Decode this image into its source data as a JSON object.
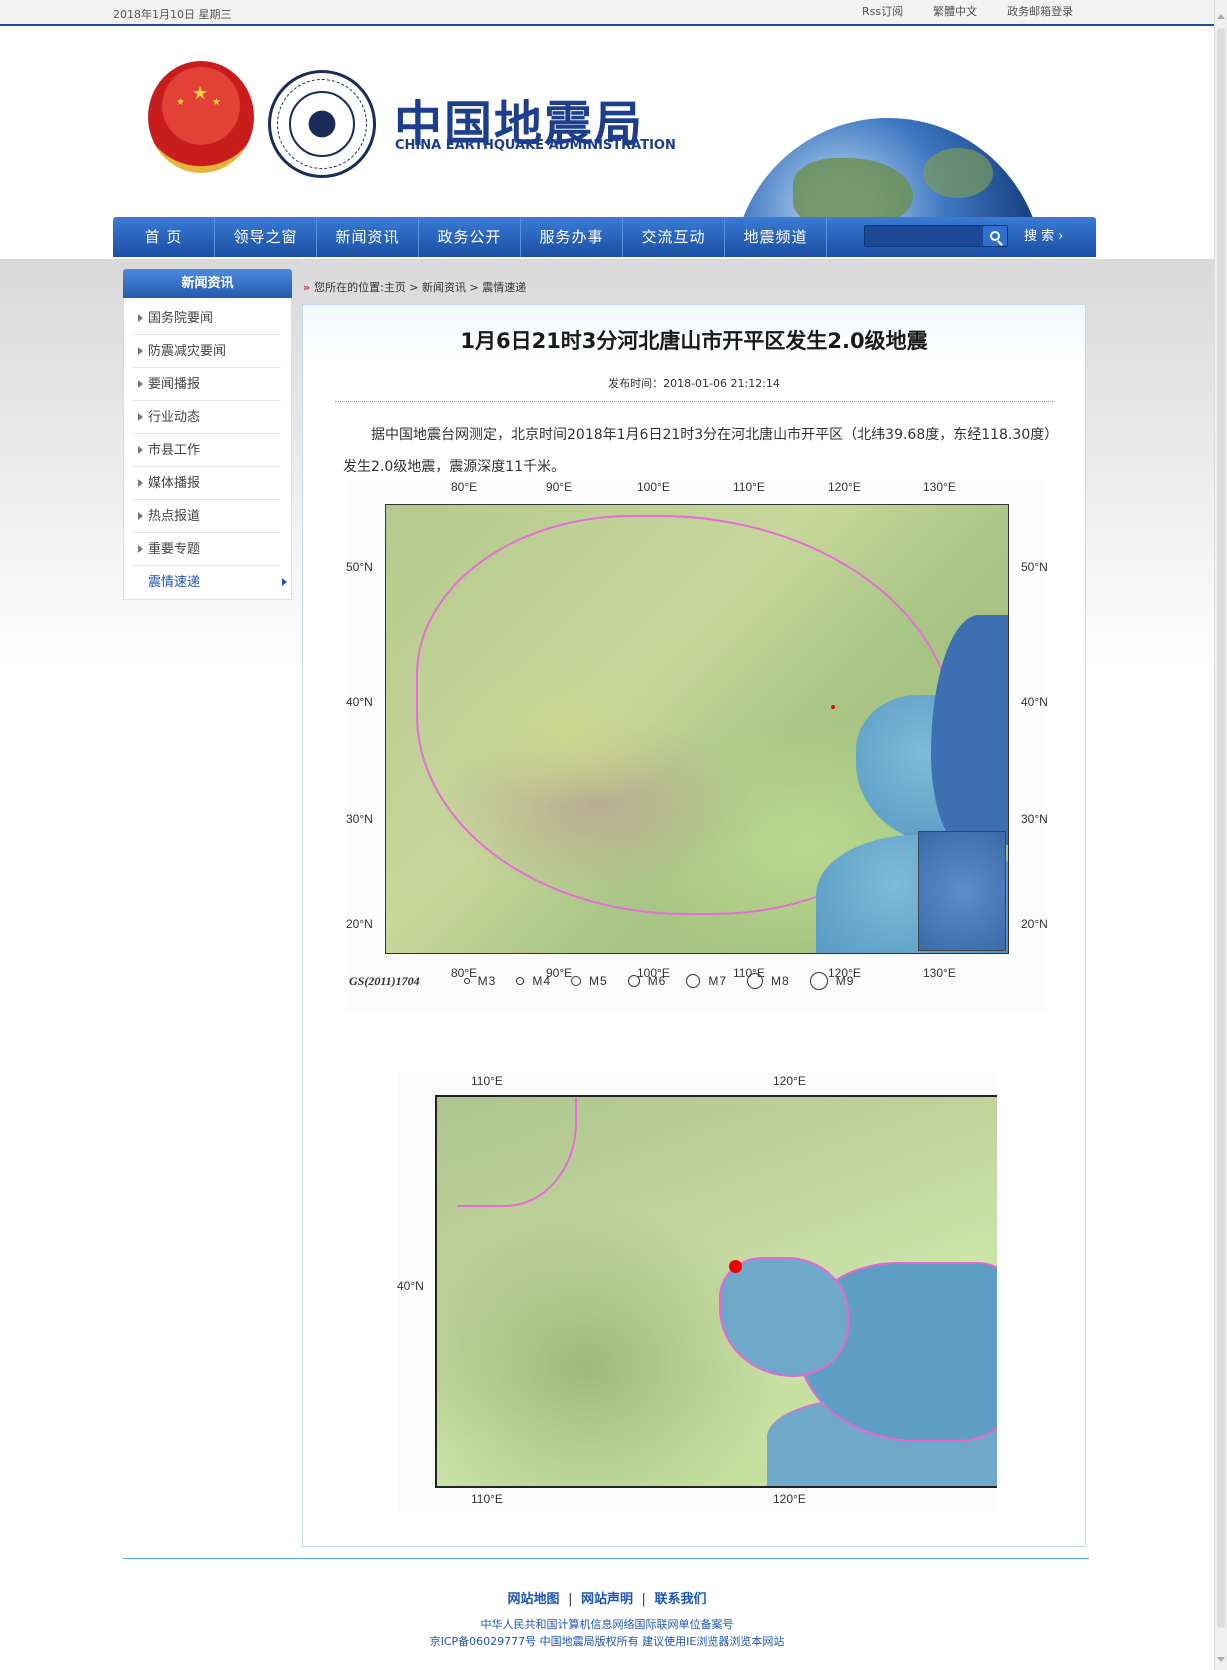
{
  "topbar": {
    "date": "2018年1月10日  星期三",
    "rss": "Rss订阅",
    "traditional": "繁體中文",
    "mail_login": "政务邮箱登录"
  },
  "logo": {
    "cn": "中国地震局",
    "en": "CHINA EARTHQUAKE ADMINISTRATION",
    "seal_text": "CHINA EARTHQUAKE ADMINISTRATION 中国地震局"
  },
  "nav": {
    "items": [
      "首  页",
      "领导之窗",
      "新闻资讯",
      "政务公开",
      "服务办事",
      "交流互动",
      "地震频道"
    ],
    "search_placeholder": "",
    "search_label": "搜  索 ›"
  },
  "sidebar": {
    "title": "新闻资讯",
    "items": [
      "国务院要闻",
      "防震减灾要闻",
      "要闻播报",
      "行业动态",
      "市县工作",
      "媒体播报",
      "热点报道",
      "重要专题",
      "震情速递"
    ],
    "active": "震情速递"
  },
  "breadcrumb": {
    "arrow": "»",
    "text": "您所在的位置:主页 > 新闻资讯 > 震情速递"
  },
  "article": {
    "title": "1月6日21时3分河北唐山市开平区发生2.0级地震",
    "pubtime": "发布时间：2018-01-06 21:12:14",
    "body": "据中国地震台网测定，北京时间2018年1月6日21时3分在河北唐山市开平区（北纬39.68度，东经118.30度）发生2.0级地震，震源深度11千米。"
  },
  "map1": {
    "lon_ticks": [
      "80°E",
      "90°E",
      "100°E",
      "110°E",
      "120°E",
      "130°E"
    ],
    "lat_ticks": [
      "50°N",
      "40°N",
      "30°N",
      "20°N"
    ],
    "gs": "GS(2011)1704",
    "legend": [
      "M3",
      "M4",
      "M5",
      "M6",
      "M7",
      "M8",
      "M9"
    ]
  },
  "map2": {
    "lon_ticks": [
      "110°E",
      "120°E"
    ],
    "lat_ticks": [
      "40°N"
    ]
  },
  "footer": {
    "links": [
      "网站地图",
      "网站声明",
      "联系我们"
    ],
    "sep": "|",
    "line1": "中华人民共和国计算机信息网络国际联网单位备案号",
    "line2": "京ICP备06029777号  中国地震局版权所有  建议使用IE浏览器浏览本网站"
  },
  "colors": {
    "brand_blue": "#1d3e8c",
    "nav_blue": "#2559ad",
    "epicenter": "#e00000",
    "border_pink": "#e36fd3"
  }
}
